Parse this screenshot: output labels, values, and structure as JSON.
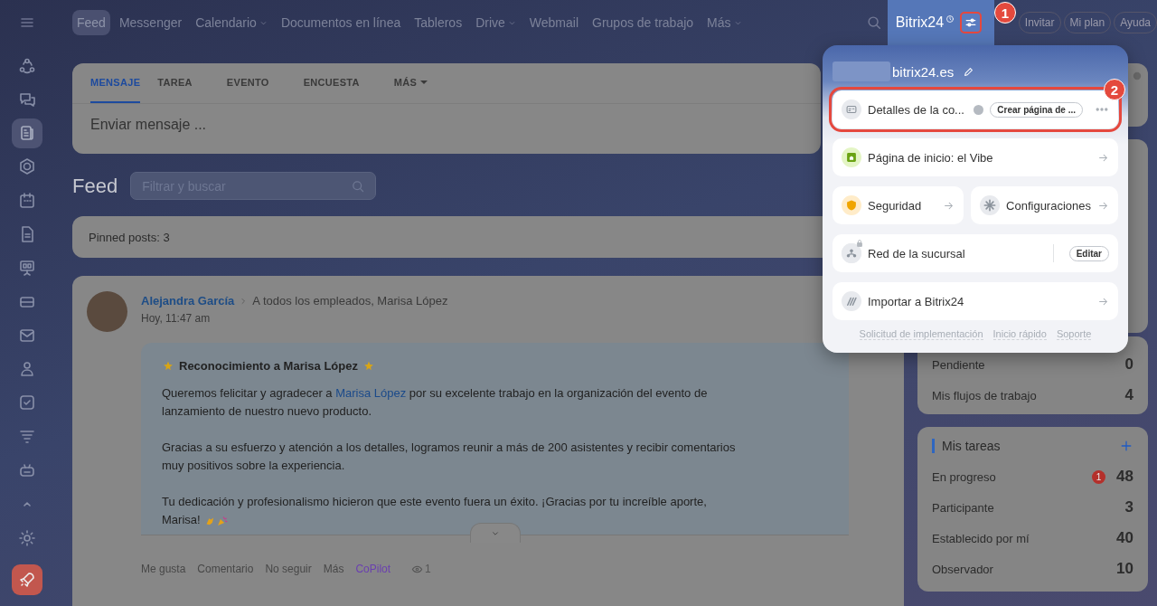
{
  "topbar": {
    "menu_items": [
      {
        "label": "Feed",
        "selected": true,
        "dropdown": false
      },
      {
        "label": "Messenger",
        "selected": false,
        "dropdown": false
      },
      {
        "label": "Calendario",
        "selected": false,
        "dropdown": true
      },
      {
        "label": "Documentos en línea",
        "selected": false,
        "dropdown": false
      },
      {
        "label": "Tableros",
        "selected": false,
        "dropdown": false
      },
      {
        "label": "Drive",
        "selected": false,
        "dropdown": true
      },
      {
        "label": "Webmail",
        "selected": false,
        "dropdown": false
      },
      {
        "label": "Grupos de trabajo",
        "selected": false,
        "dropdown": false
      },
      {
        "label": "Más",
        "selected": false,
        "dropdown": true
      }
    ],
    "portal": {
      "name": "Bitrix24",
      "annotation": "1"
    },
    "buttons": [
      "Invitar",
      "Mi plan",
      "Ayuda"
    ]
  },
  "sidebar": {
    "items": [
      {
        "kind": "cycle",
        "selected": false
      },
      {
        "kind": "chat",
        "selected": false
      },
      {
        "kind": "news",
        "selected": true
      },
      {
        "kind": "hexagon",
        "selected": false
      },
      {
        "kind": "calendar",
        "selected": false
      },
      {
        "kind": "file",
        "selected": false
      },
      {
        "kind": "board",
        "selected": false
      },
      {
        "kind": "card",
        "selected": false
      },
      {
        "kind": "mail",
        "selected": false
      },
      {
        "kind": "people",
        "selected": false
      },
      {
        "kind": "check",
        "selected": false
      },
      {
        "kind": "filter",
        "selected": false
      },
      {
        "kind": "robot",
        "selected": false
      },
      {
        "kind": "collapse",
        "selected": false
      }
    ],
    "bottom": [
      {
        "kind": "settings"
      },
      {
        "kind": "rocket"
      }
    ]
  },
  "composer": {
    "tabs": [
      {
        "label": "MENSAJE",
        "selected": true,
        "dropdown": false
      },
      {
        "label": "TAREA",
        "selected": false,
        "dropdown": false
      },
      {
        "label": "EVENTO",
        "selected": false,
        "dropdown": false
      },
      {
        "label": "ENCUESTA",
        "selected": false,
        "dropdown": false
      },
      {
        "label": "MÁS",
        "selected": false,
        "dropdown": true
      }
    ],
    "placeholder": "Enviar mensaje ..."
  },
  "feed": {
    "title": "Feed",
    "search_placeholder": "Filtrar y buscar",
    "pinned": "Pinned posts: 3"
  },
  "post": {
    "author": "Alejandra García",
    "recipients": "A todos los empleados, Marisa López",
    "time": "Hoy, 11:47 am",
    "title": "Reconocimiento a Marisa López",
    "paragraphs": [
      {
        "before": "Queremos felicitar y agradecer a ",
        "link": "Marisa López",
        "after": " por su excelente trabajo en la organización del evento de lanzamiento de nuestro nuevo producto."
      },
      {
        "before": "Gracias a su esfuerzo y atención a los detalles, logramos reunir a más de 200 asistentes y recibir comentarios muy positivos sobre la experiencia."
      },
      {
        "before": "Tu dedicación y profesionalismo hicieron que este evento fuera un éxito. ¡Gracias por tu increíble aporte, Marisa!",
        "emoji": true
      }
    ],
    "actions": [
      {
        "label": "Me gusta",
        "kind": "plain"
      },
      {
        "label": "Comentario",
        "kind": "plain"
      },
      {
        "label": "No seguir",
        "kind": "plain"
      },
      {
        "label": "Más",
        "kind": "plain"
      },
      {
        "label": "CoPilot",
        "kind": "copilot"
      }
    ],
    "views": "1"
  },
  "right": {
    "flows": [
      {
        "label": "Pendiente",
        "value": "0"
      },
      {
        "label": "Mis flujos de trabajo",
        "value": "4"
      }
    ],
    "tasks": {
      "title": "Mis tareas",
      "rows": [
        {
          "label": "En progreso",
          "value": "48",
          "badge": "1"
        },
        {
          "label": "Participante",
          "value": "3"
        },
        {
          "label": "Establecido por mí",
          "value": "40"
        },
        {
          "label": "Observador",
          "value": "10"
        }
      ]
    }
  },
  "popup": {
    "domain": "bitrix24.es",
    "rows": [
      [
        {
          "kind": "details",
          "label": "Detalles de la co...",
          "button": "Crear página de ...",
          "highlighted": true,
          "annotation": "2"
        }
      ],
      [
        {
          "kind": "home",
          "label": "Página de inicio: el Vibe"
        }
      ],
      [
        {
          "kind": "security",
          "label": "Seguridad"
        },
        {
          "kind": "settings",
          "label": "Configuraciones"
        }
      ],
      [
        {
          "kind": "network",
          "label": "Red de la sucursal",
          "button": "Editar",
          "locked": true
        }
      ],
      [
        {
          "kind": "import",
          "label": "Importar a Bitrix24"
        }
      ]
    ],
    "footer": [
      "Solicitud de implementación",
      "Inicio rápido",
      "Soporte"
    ]
  }
}
